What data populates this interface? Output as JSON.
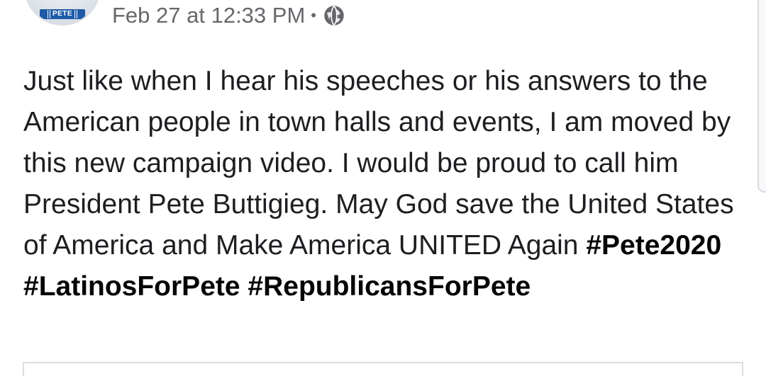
{
  "post": {
    "timestamp": "Feb 27 at 12:33 PM",
    "separator": "•",
    "privacy_icon": "globe-icon",
    "avatar_badge": "PETE",
    "body_text": "Just like when I hear his speeches or his answers to the American people in town halls and events, I am moved by this new campaign video. I would be proud to call him President Pete Buttigieg. May God save the United States of America and Make America UNITED Again",
    "hashtags": [
      "#Pete2020",
      "#LatinosForPete",
      "#RepublicansForPete"
    ]
  },
  "colors": {
    "meta_gray": "#65676b",
    "text": "#1c1e21",
    "badge_blue": "#1f5ba8"
  }
}
